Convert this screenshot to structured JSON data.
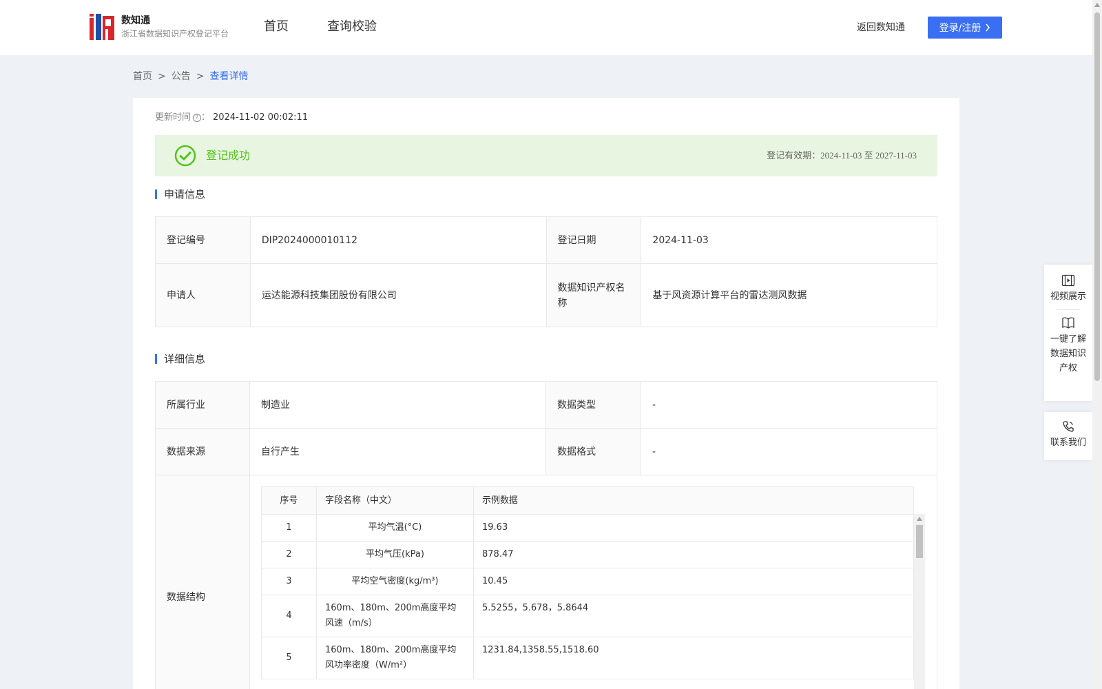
{
  "header": {
    "brand_name": "数知通",
    "brand_sub": "浙江省数据知识产权登记平台",
    "nav": [
      "首页",
      "查询校验"
    ],
    "back_link": "返回数知通",
    "login_label": "登录/注册"
  },
  "breadcrumb": [
    "首页",
    ">",
    "公告",
    ">",
    "查看详情"
  ],
  "update": {
    "label": "更新时间",
    "colon": "：",
    "value": "2024-11-02 00:02:11"
  },
  "status": {
    "text": "登记成功",
    "validity_label": "登记有效期：",
    "validity_dates": "2024-11-03 至 2027-11-03",
    "color": "#52c41a"
  },
  "section_apply": "申请信息",
  "apply": {
    "reg_no_label": "登记编号",
    "reg_no": "DIP2024000010112",
    "reg_date_label": "登记日期",
    "reg_date": "2024-11-03",
    "applicant_label": "申请人",
    "applicant": "运达能源科技集团股份有限公司",
    "ip_name_label": "数据知识产权名称",
    "ip_name": "基于风资源计算平台的雷达测风数据"
  },
  "section_detail": "详细信息",
  "detail": {
    "industry_label": "所属行业",
    "industry": "制造业",
    "type_label": "数据类型",
    "type": "-",
    "source_label": "数据来源",
    "source": "自行产生",
    "format_label": "数据格式",
    "format": "-",
    "structure_label": "数据结构"
  },
  "structure": {
    "headers": [
      "序号",
      "字段名称（中文）",
      "示例数据"
    ],
    "rows": [
      [
        "1",
        "平均气温(°C)",
        "19.63"
      ],
      [
        "2",
        "平均气压(kPa)",
        "878.47"
      ],
      [
        "3",
        "平均空气密度(kg/m³)",
        "10.45"
      ],
      [
        "4",
        "160m、180m、200m高度平均风速（m/s）",
        "5.5255，5.678，5.8644"
      ],
      [
        "5",
        "160m、180m、200m高度平均风功率密度（W/m²）",
        "1231.84,1358.55,1518.60"
      ]
    ]
  },
  "float_panel": {
    "video": "视频展示",
    "learn": "一键了解数据知识产权",
    "contact": "联系我们"
  },
  "colors": {
    "accent": "#3a6ff4",
    "success": "#52c41a",
    "success_bg": "#e8f6e1"
  }
}
